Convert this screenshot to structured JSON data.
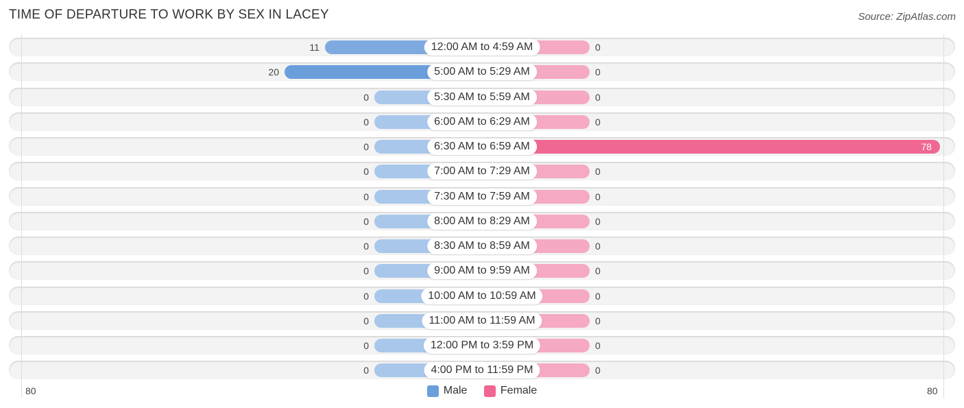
{
  "title": "TIME OF DEPARTURE TO WORK BY SEX IN LACEY",
  "source": "Source: ZipAtlas.com",
  "colors": {
    "male": "#6a9fdc",
    "male_light": "#a9c7eb",
    "female": "#f06792",
    "female_light": "#f5a9c2"
  },
  "chart_data": {
    "type": "bar",
    "orientation": "horizontal-diverging",
    "title": "TIME OF DEPARTURE TO WORK BY SEX IN LACEY",
    "categories": [
      "12:00 AM to 4:59 AM",
      "5:00 AM to 5:29 AM",
      "5:30 AM to 5:59 AM",
      "6:00 AM to 6:29 AM",
      "6:30 AM to 6:59 AM",
      "7:00 AM to 7:29 AM",
      "7:30 AM to 7:59 AM",
      "8:00 AM to 8:29 AM",
      "8:30 AM to 8:59 AM",
      "9:00 AM to 9:59 AM",
      "10:00 AM to 10:59 AM",
      "11:00 AM to 11:59 AM",
      "12:00 PM to 3:59 PM",
      "4:00 PM to 11:59 PM"
    ],
    "series": [
      {
        "name": "Male",
        "values": [
          11,
          20,
          0,
          0,
          0,
          0,
          0,
          0,
          0,
          0,
          0,
          0,
          0,
          0
        ]
      },
      {
        "name": "Female",
        "values": [
          0,
          0,
          0,
          0,
          78,
          0,
          0,
          0,
          0,
          0,
          0,
          0,
          0,
          0
        ]
      }
    ],
    "axis": {
      "left_tick": "80",
      "right_tick": "80",
      "range": [
        0,
        80
      ]
    },
    "legend": {
      "position": "bottom-center",
      "entries": [
        "Male",
        "Female"
      ]
    },
    "xlabel": "",
    "ylabel": ""
  }
}
